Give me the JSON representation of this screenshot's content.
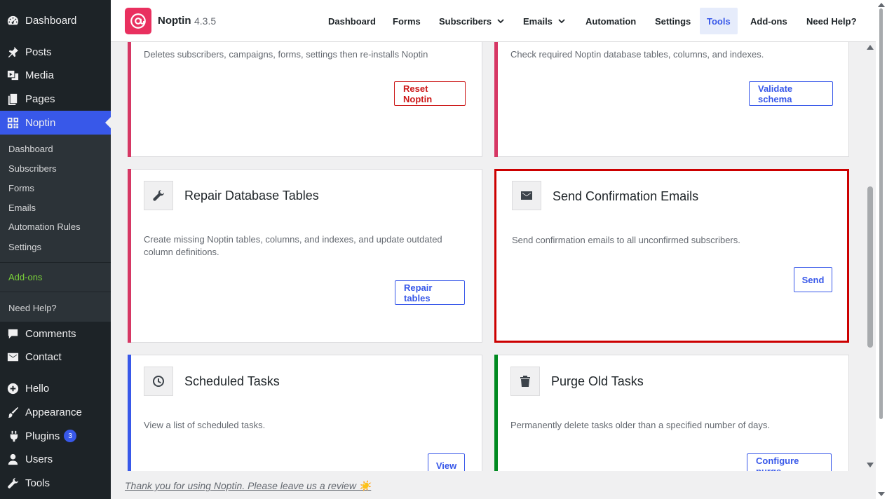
{
  "sidebar": {
    "dashboard": "Dashboard",
    "posts": "Posts",
    "media": "Media",
    "pages": "Pages",
    "noptin": "Noptin",
    "submenu": [
      "Dashboard",
      "Subscribers",
      "Forms",
      "Emails",
      "Automation Rules",
      "Settings"
    ],
    "addons": "Add-ons",
    "need_help": "Need Help?",
    "comments": "Comments",
    "contact": "Contact",
    "hello": "Hello",
    "appearance": "Appearance",
    "plugins": "Plugins",
    "plugins_badge": "3",
    "users": "Users",
    "tools": "Tools"
  },
  "header": {
    "brand": "Noptin",
    "version": "4.3.5",
    "nav": {
      "dashboard": "Dashboard",
      "forms": "Forms",
      "subscribers": "Subscribers",
      "emails": "Emails",
      "automation": "Automation",
      "settings": "Settings",
      "tools": "Tools",
      "addons": "Add-ons",
      "need_help": "Need Help?"
    }
  },
  "cards": {
    "reset": {
      "desc": "Deletes subscribers, campaigns, forms, settings then re-installs Noptin",
      "button": "Reset Noptin"
    },
    "validate": {
      "desc": "Check required Noptin database tables, columns, and indexes.",
      "button": "Validate schema"
    },
    "repair": {
      "title": "Repair Database Tables",
      "desc": "Create missing Noptin tables, columns, and indexes, and update outdated column definitions.",
      "button": "Repair tables"
    },
    "send": {
      "title": "Send Confirmation Emails",
      "desc": "Send confirmation emails to all unconfirmed subscribers.",
      "button": "Send"
    },
    "scheduled": {
      "title": "Scheduled Tasks",
      "desc": "View a list of scheduled tasks.",
      "button": "View"
    },
    "purge": {
      "title": "Purge Old Tasks",
      "desc": "Permanently delete tasks older than a specified number of days.",
      "button": "Configure purge"
    }
  },
  "footer": {
    "text": "Thank you for using Noptin. Please leave us a review ☀️"
  },
  "colors": {
    "accent": "#3858e9",
    "danger_stripe": "#d63764",
    "info_stripe": "#3858e9",
    "success_stripe": "#008a20",
    "highlight_border": "#cc0000"
  }
}
